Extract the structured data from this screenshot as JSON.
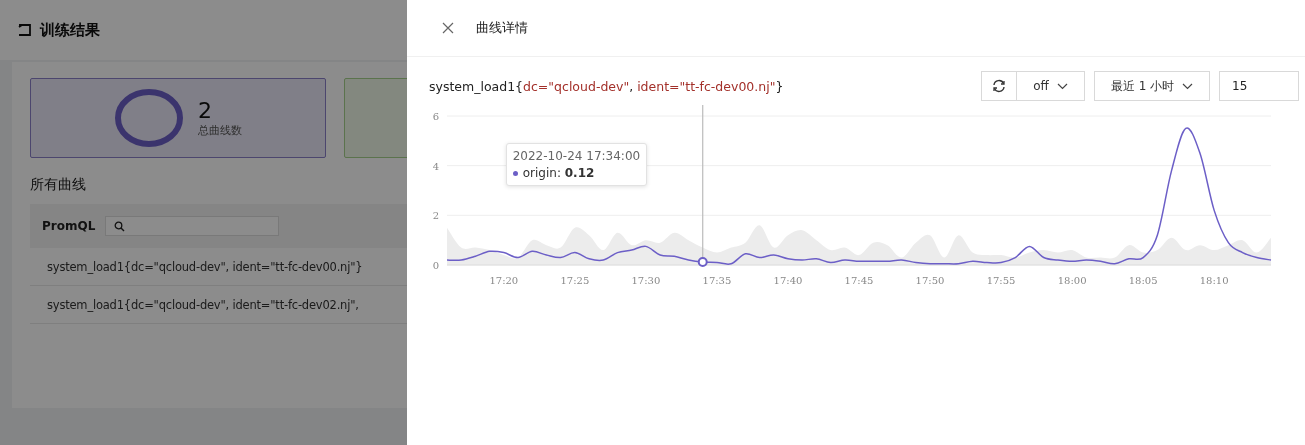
{
  "page": {
    "title": "训练结果",
    "stat_cards": [
      {
        "kind": "total",
        "value": "2",
        "label": "总曲线数"
      },
      {
        "kind": "other"
      }
    ],
    "section_title": "所有曲线",
    "filter": {
      "label": "PromQL"
    },
    "rows": [
      "system_load1{dc=\"qcloud-dev\", ident=\"tt-fc-dev00.nj\"}",
      "system_load1{dc=\"qcloud-dev\", ident=\"tt-fc-dev02.nj\","
    ]
  },
  "drawer": {
    "title": "曲线详情",
    "chart_title": [
      {
        "kind": "name",
        "text": "system_load1{"
      },
      {
        "kind": "label",
        "text": "dc=\"qcloud-dev\""
      },
      {
        "kind": "name",
        "text": ", "
      },
      {
        "kind": "label",
        "text": "ident=\"tt-fc-dev00.nj\""
      },
      {
        "kind": "name",
        "text": "}"
      }
    ],
    "controls": {
      "refresh": "off",
      "range": "最近 1 小时",
      "step": "15"
    },
    "chart_data": {
      "type": "line",
      "categories": [
        null,
        null,
        null,
        null,
        "17:20",
        null,
        null,
        null,
        null,
        "17:25",
        null,
        null,
        null,
        null,
        "17:30",
        null,
        null,
        null,
        null,
        "17:35",
        null,
        null,
        null,
        null,
        "17:40",
        null,
        null,
        null,
        null,
        "17:45",
        null,
        null,
        null,
        null,
        "17:50",
        null,
        null,
        null,
        null,
        "17:55",
        null,
        null,
        null,
        null,
        "18:00",
        null,
        null,
        null,
        null,
        "18:05",
        null,
        null,
        null,
        null,
        "18:10",
        null,
        null,
        null,
        null
      ],
      "series": [
        {
          "name": "origin",
          "color": "#6c5fc7",
          "values": [
            0.2,
            0.2,
            0.35,
            0.55,
            0.5,
            0.3,
            0.55,
            0.4,
            0.3,
            0.5,
            0.25,
            0.2,
            0.5,
            0.6,
            0.75,
            0.4,
            0.35,
            0.2,
            0.12,
            0.1,
            0.05,
            0.45,
            0.3,
            0.4,
            0.25,
            0.2,
            0.25,
            0.1,
            0.2,
            0.15,
            0.15,
            0.15,
            0.2,
            0.1,
            0.05,
            0.05,
            0.05,
            0.15,
            0.1,
            0.1,
            0.3,
            0.75,
            0.3,
            0.2,
            0.15,
            0.2,
            0.15,
            0.05,
            0.25,
            0.3,
            1.2,
            3.8,
            5.5,
            4.5,
            2.2,
            0.9,
            0.5,
            0.3,
            0.2
          ]
        }
      ],
      "ylim": [
        0,
        6
      ],
      "yticks": [
        0,
        2,
        4,
        6
      ],
      "annotations": [
        "2022-10-24 17:34:00",
        ": **0.12**"
      ]
    }
  }
}
